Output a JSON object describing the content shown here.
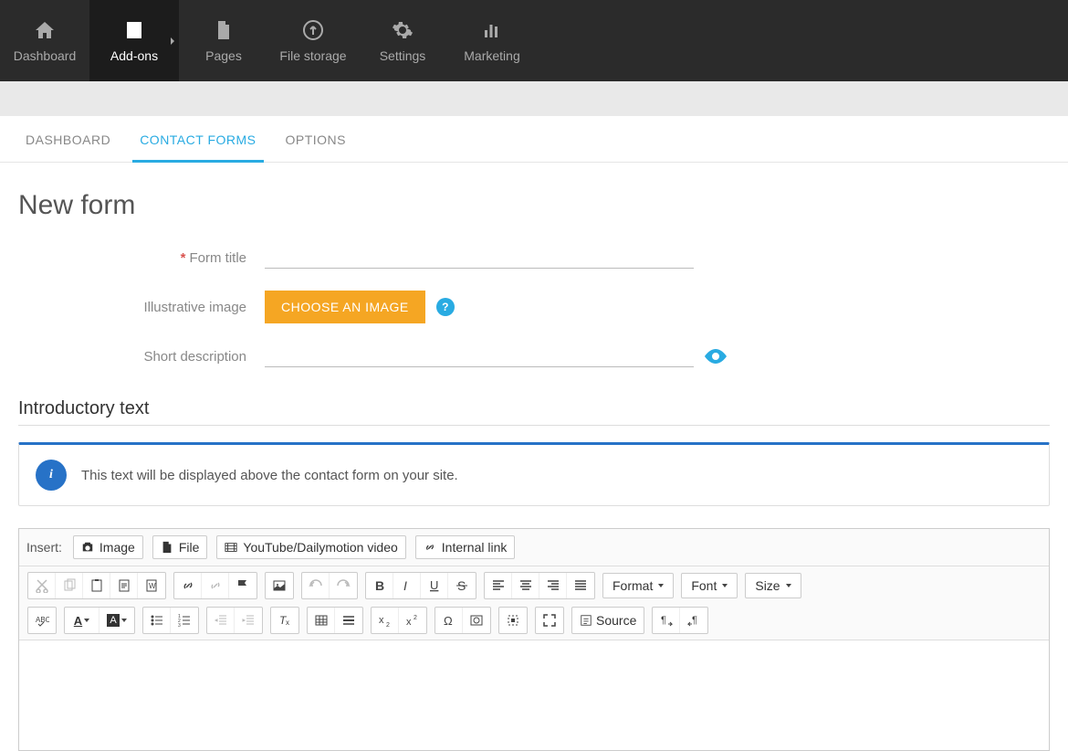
{
  "topnav": [
    {
      "label": "Dashboard",
      "icon": "home"
    },
    {
      "label": "Add-ons",
      "icon": "document",
      "active": true
    },
    {
      "label": "Pages",
      "icon": "file"
    },
    {
      "label": "File storage",
      "icon": "upload"
    },
    {
      "label": "Settings",
      "icon": "gear"
    },
    {
      "label": "Marketing",
      "icon": "bars"
    }
  ],
  "tabs": [
    {
      "label": "DASHBOARD"
    },
    {
      "label": "CONTACT FORMS",
      "active": true
    },
    {
      "label": "OPTIONS"
    }
  ],
  "page_title": "New form",
  "form": {
    "title_label": "Form title",
    "title_value": "",
    "image_label": "Illustrative image",
    "image_button": "CHOOSE AN IMAGE",
    "short_desc_label": "Short description",
    "short_desc_value": ""
  },
  "section_title": "Introductory text",
  "info_text": "This text will be displayed above the contact form on your site.",
  "editor": {
    "insert_label": "Insert:",
    "insert_buttons": {
      "image": "Image",
      "file": "File",
      "video": "YouTube/Dailymotion video",
      "link": "Internal link"
    },
    "dropdowns": {
      "format": "Format",
      "font": "Font",
      "size": "Size"
    },
    "source_label": "Source"
  }
}
